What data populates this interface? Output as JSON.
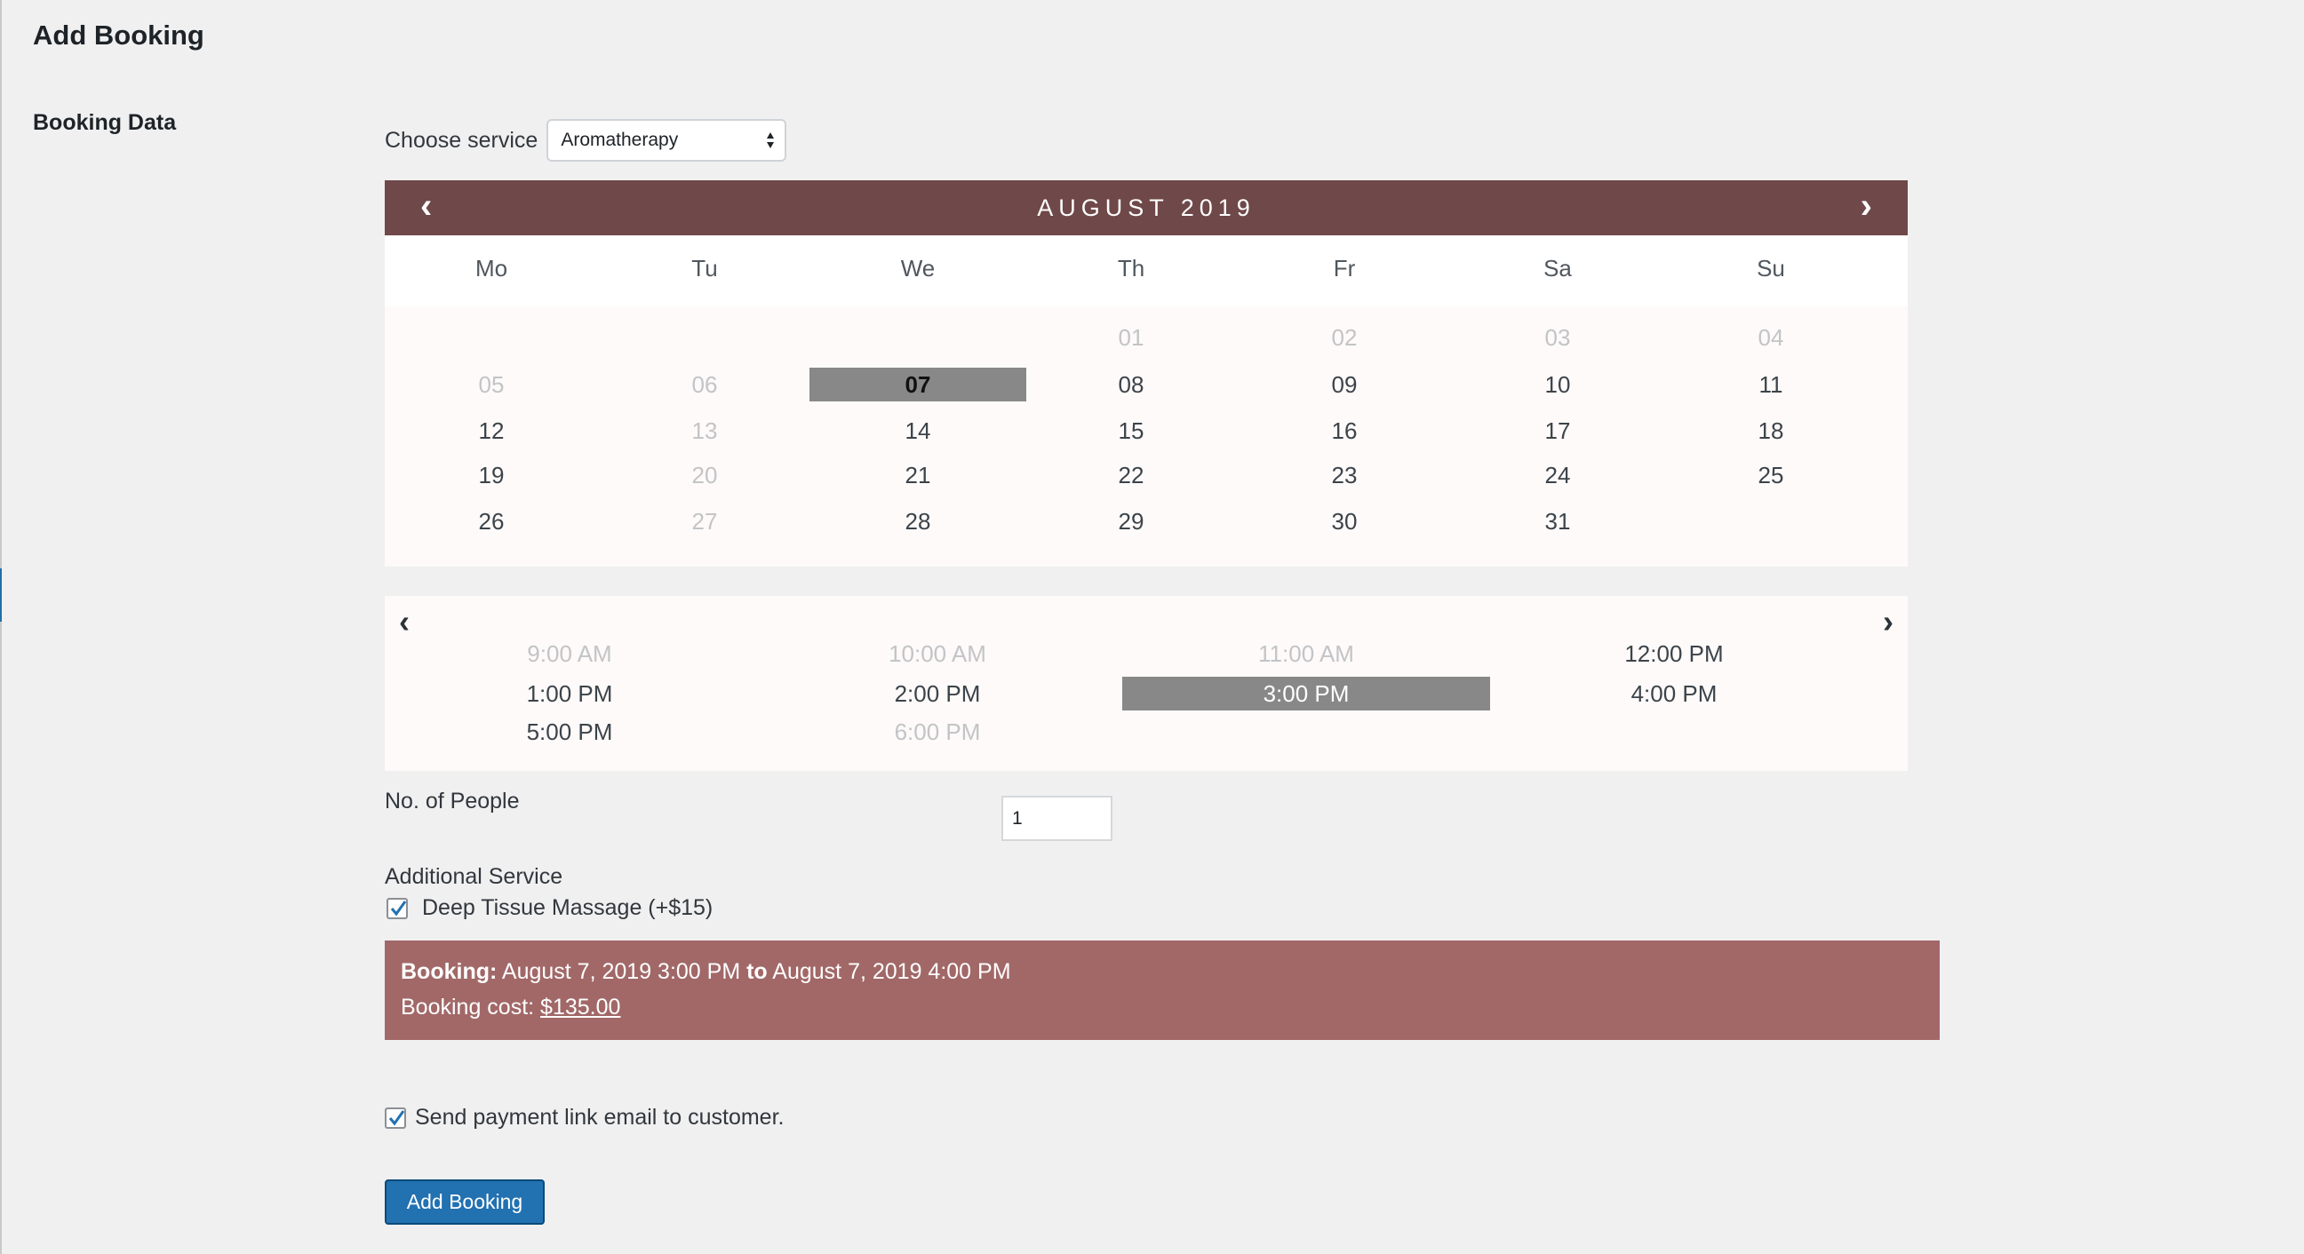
{
  "page": {
    "title": "Add Booking",
    "section_label": "Booking Data"
  },
  "service": {
    "label": "Choose service",
    "selected": "Aromatherapy"
  },
  "calendar": {
    "month_label": "AUGUST 2019",
    "weekdays": [
      "Mo",
      "Tu",
      "We",
      "Th",
      "Fr",
      "Sa",
      "Su"
    ],
    "weeks": [
      [
        null,
        null,
        null,
        {
          "label": "01",
          "state": "unavailable"
        },
        {
          "label": "02",
          "state": "unavailable"
        },
        {
          "label": "03",
          "state": "unavailable"
        },
        {
          "label": "04",
          "state": "unavailable"
        }
      ],
      [
        {
          "label": "05",
          "state": "unavailable"
        },
        {
          "label": "06",
          "state": "unavailable"
        },
        {
          "label": "07",
          "state": "selected"
        },
        {
          "label": "08",
          "state": "available"
        },
        {
          "label": "09",
          "state": "available"
        },
        {
          "label": "10",
          "state": "available"
        },
        {
          "label": "11",
          "state": "available"
        }
      ],
      [
        {
          "label": "12",
          "state": "available"
        },
        {
          "label": "13",
          "state": "unavailable"
        },
        {
          "label": "14",
          "state": "available"
        },
        {
          "label": "15",
          "state": "available"
        },
        {
          "label": "16",
          "state": "available"
        },
        {
          "label": "17",
          "state": "available"
        },
        {
          "label": "18",
          "state": "available"
        }
      ],
      [
        {
          "label": "19",
          "state": "available"
        },
        {
          "label": "20",
          "state": "unavailable"
        },
        {
          "label": "21",
          "state": "available"
        },
        {
          "label": "22",
          "state": "available"
        },
        {
          "label": "23",
          "state": "available"
        },
        {
          "label": "24",
          "state": "available"
        },
        {
          "label": "25",
          "state": "available"
        }
      ],
      [
        {
          "label": "26",
          "state": "available"
        },
        {
          "label": "27",
          "state": "unavailable"
        },
        {
          "label": "28",
          "state": "available"
        },
        {
          "label": "29",
          "state": "available"
        },
        {
          "label": "30",
          "state": "available"
        },
        {
          "label": "31",
          "state": "available"
        },
        null
      ]
    ]
  },
  "time_slots": [
    {
      "label": "9:00 AM",
      "state": "unavailable"
    },
    {
      "label": "10:00 AM",
      "state": "unavailable"
    },
    {
      "label": "11:00 AM",
      "state": "unavailable"
    },
    {
      "label": "12:00 PM",
      "state": "available"
    },
    {
      "label": "1:00 PM",
      "state": "available"
    },
    {
      "label": "2:00 PM",
      "state": "available"
    },
    {
      "label": "3:00 PM",
      "state": "selected"
    },
    {
      "label": "4:00 PM",
      "state": "available"
    },
    {
      "label": "5:00 PM",
      "state": "available"
    },
    {
      "label": "6:00 PM",
      "state": "unavailable"
    }
  ],
  "people": {
    "label": "No. of People",
    "value": "1"
  },
  "additional_service": {
    "label": "Additional Service",
    "option_label": "Deep Tissue Massage (+$15)",
    "checked": true
  },
  "summary": {
    "booking_label": "Booking:",
    "start": "August 7, 2019 3:00 PM",
    "to_label": "to",
    "end": "August 7, 2019 4:00 PM",
    "cost_label": "Booking cost:",
    "cost_value": "$135.00"
  },
  "email": {
    "label": "Send payment link email to customer.",
    "checked": true
  },
  "submit": {
    "label": "Add Booking"
  },
  "colors": {
    "calendar_header": "#6f4849",
    "summary_background": "#a26868",
    "selected_slot": "#888888",
    "primary_button": "#2271b1"
  }
}
